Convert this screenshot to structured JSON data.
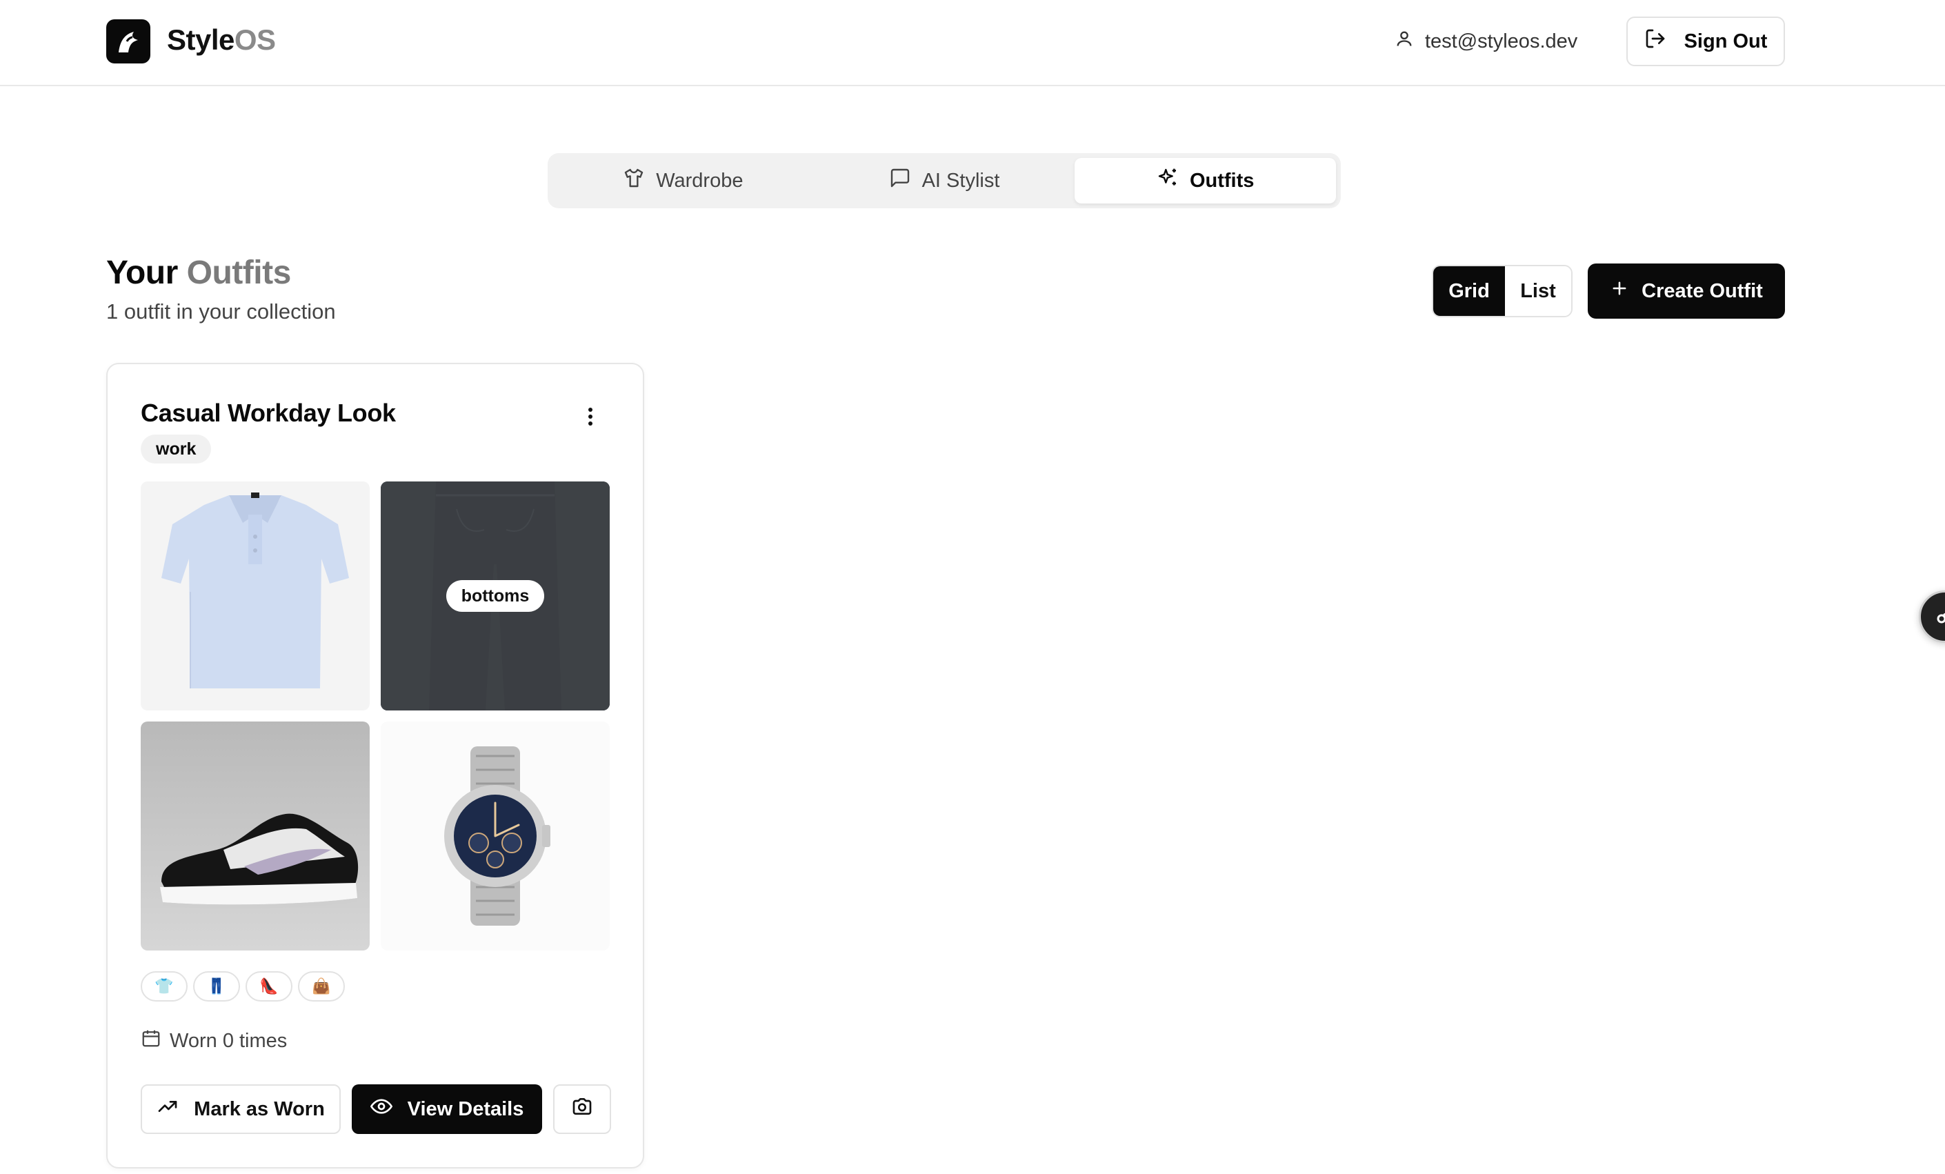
{
  "header": {
    "brand_primary": "Style",
    "brand_secondary": "OS",
    "user_email": "test@styleos.dev",
    "sign_out_label": "Sign Out"
  },
  "tabs": [
    {
      "label": "Wardrobe",
      "icon": "shirt-icon",
      "active": false
    },
    {
      "label": "AI Stylist",
      "icon": "chat-bubble-icon",
      "active": false
    },
    {
      "label": "Outfits",
      "icon": "sparkles-icon",
      "active": true
    }
  ],
  "section": {
    "title_primary": "Your",
    "title_secondary": "Outfits",
    "subtitle": "1 outfit in your collection"
  },
  "view_toggle": {
    "grid_label": "Grid",
    "list_label": "List",
    "selected": "Grid"
  },
  "create_button_label": "Create Outfit",
  "outfits": [
    {
      "name": "Casual Workday Look",
      "tag": "work",
      "items": [
        {
          "category": "top",
          "description": "light blue polo shirt"
        },
        {
          "category": "bottoms",
          "description": "dark denim jeans"
        },
        {
          "category": "shoes",
          "description": "black and white low sneakers"
        },
        {
          "category": "accessory",
          "description": "silver chronograph watch"
        }
      ],
      "hover_label": "bottoms",
      "category_chips": [
        "👕",
        "👖",
        "👠",
        "👜"
      ],
      "worn_text": "Worn 0 times",
      "mark_worn_label": "Mark as Worn",
      "view_details_label": "View Details"
    }
  ],
  "colors": {
    "primary": "#0a0a0a",
    "muted_text": "#7a7a7a",
    "border": "#e2e2e2",
    "tab_bg": "#f1f1f1"
  }
}
